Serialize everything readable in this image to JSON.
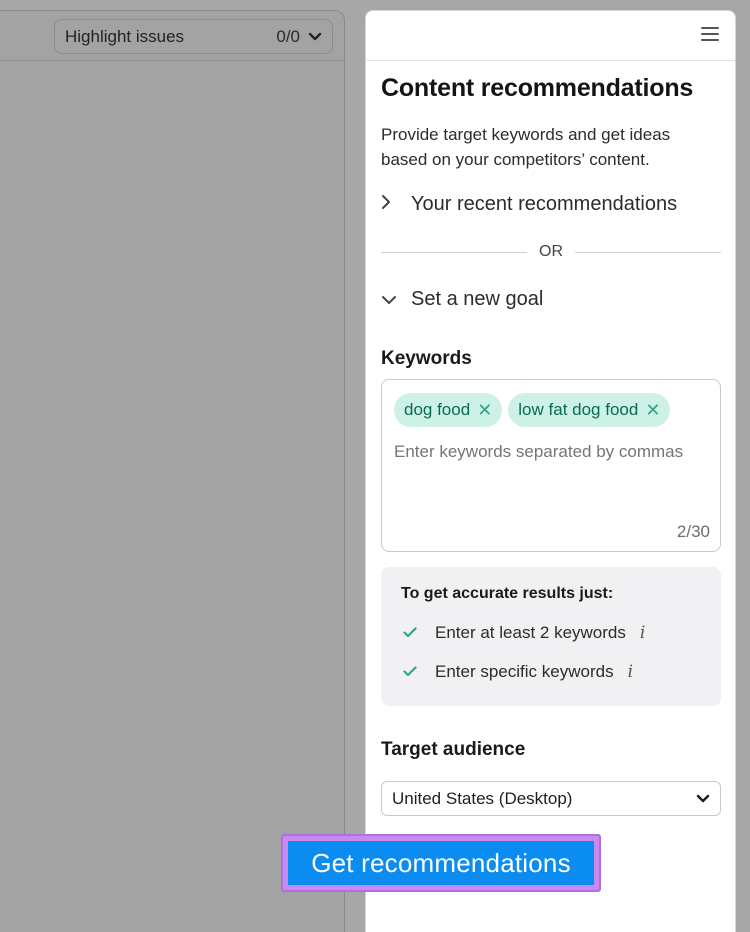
{
  "editor": {
    "highlight_label": "Highlight issues",
    "highlight_count": "0/0"
  },
  "sidebar": {
    "title": "Content recommendations",
    "description": "Provide target keywords and get ideas based on your competitors’ content.",
    "recent_label": "Your recent recommendations",
    "divider_text": "OR",
    "goal_label": "Set a new goal",
    "keywords": {
      "label": "Keywords",
      "chips": [
        "dog food",
        "low fat dog food"
      ],
      "placeholder": "Enter keywords separated by commas",
      "count": "2/30"
    },
    "tips": {
      "title": "To get accurate results just:",
      "items": [
        "Enter at least 2 keywords",
        "Enter specific keywords"
      ],
      "info_glyph": "i"
    },
    "audience": {
      "label": "Target audience",
      "selected": "United States (Desktop)"
    },
    "cta_label": "Get recommendations"
  },
  "colors": {
    "accent": "#0a8cf0",
    "highlight_frame": "#c98af0",
    "chip_bg": "#cdf1e7",
    "chip_text": "#0a6b52",
    "check": "#2fa686"
  },
  "icons": {
    "menu": "hamburger-icon",
    "chevron_down": "chevron-down-icon",
    "chevron_right": "chevron-right-icon",
    "remove": "close-icon",
    "check": "check-icon",
    "info": "info-icon"
  }
}
